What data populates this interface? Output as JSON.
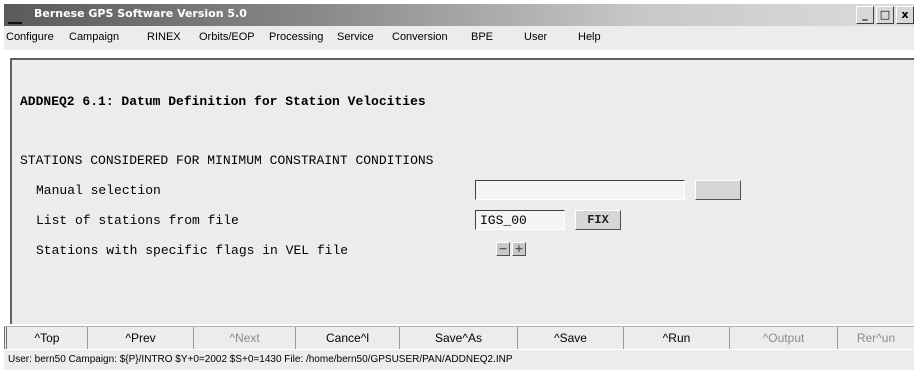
{
  "window": {
    "title": "Bernese GPS Software Version 5.0",
    "minimize": "_",
    "maximize": "□",
    "close": "x"
  },
  "menu": [
    "Configure",
    "Campaign",
    "RINEX",
    "Orbits/EOP",
    "Processing",
    "Service",
    "Conversion",
    "BPE",
    "User",
    "Help"
  ],
  "panel": {
    "heading": "ADDNEQ2 6.1: Datum Definition for Station Velocities",
    "section": "STATIONS CONSIDERED FOR MINIMUM CONSTRAINT CONDITIONS",
    "manual_label": "Manual selection",
    "manual_value": "",
    "file_label": "List of stations from file",
    "file_value": "IGS_00",
    "fix_label": "FIX",
    "flags_label": "Stations with specific flags in VEL file"
  },
  "nav": [
    {
      "label": "^Top",
      "enabled": true
    },
    {
      "label": "^Prev",
      "enabled": true
    },
    {
      "label": "^Next",
      "enabled": false
    },
    {
      "label": "Cance^l",
      "enabled": true
    },
    {
      "label": "Save^As",
      "enabled": true
    },
    {
      "label": "^Save",
      "enabled": true
    },
    {
      "label": "^Run",
      "enabled": true
    },
    {
      "label": "^Output",
      "enabled": false
    },
    {
      "label": "Rer^un",
      "enabled": false
    }
  ],
  "status": "User: bern50  Campaign: ${P}/INTRO  $Y+0=2002  $S+0=1430  File: /home/bern50/GPSUSER/PAN/ADDNEQ2.INP"
}
